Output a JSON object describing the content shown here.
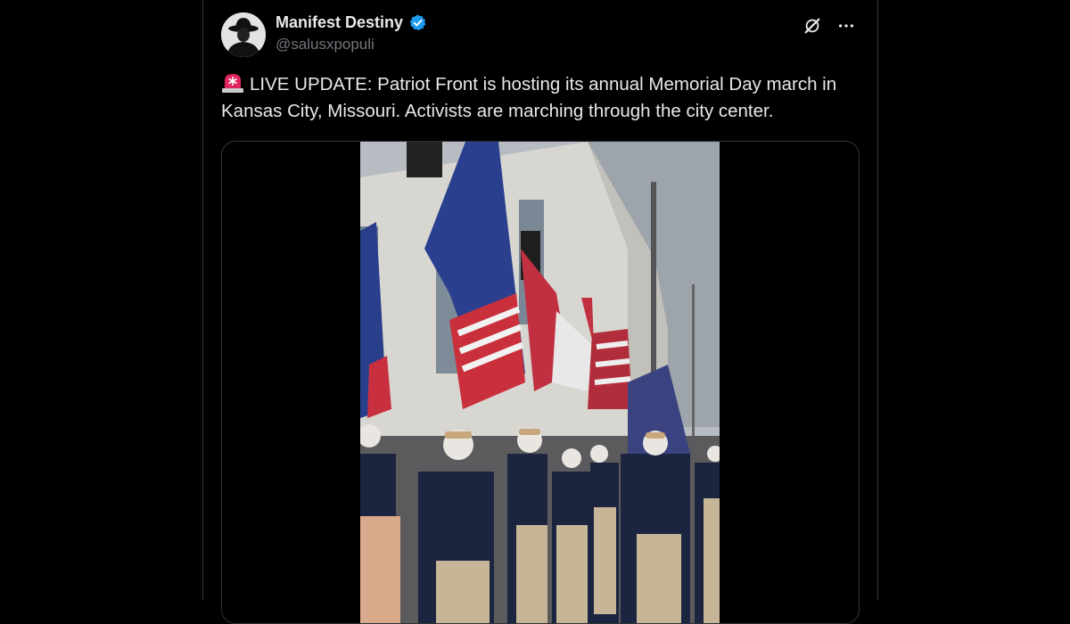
{
  "tweet": {
    "author": {
      "display_name": "Manifest Destiny",
      "handle": "@salusxpopuli",
      "verified": true
    },
    "text": "LIVE UPDATE: Patriot Front is hosting its annual Memorial Day march in Kansas City, Missouri. Activists are marching through the city center.",
    "leading_emoji": "rotating-light-siren",
    "media": {
      "type": "video"
    },
    "actions": [
      "grok-icon",
      "more-options-icon"
    ]
  },
  "colors": {
    "background": "#000000",
    "text": "#e7e9ea",
    "secondary_text": "#71767b",
    "border": "#2f3336",
    "verified_badge": "#1d9bf0"
  }
}
